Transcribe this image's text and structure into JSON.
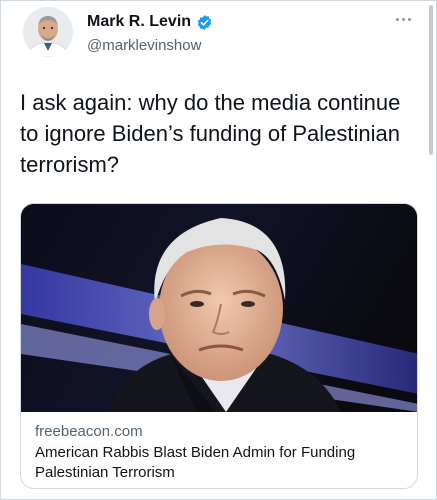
{
  "tweet": {
    "display_name": "Mark R. Levin",
    "handle": "@marklevinshow",
    "verified": true,
    "text": "I ask again: why do the media continue to ignore Biden’s funding of Palestinian terrorism?"
  },
  "card": {
    "domain": "freebeacon.com",
    "title": "American Rabbis Blast Biden Admin for Funding Palestinian Terrorism"
  },
  "icons": {
    "verified": "verified-badge-icon",
    "more": "more-options-icon"
  },
  "colors": {
    "verified_blue": "#1d9bf0",
    "secondary_text": "#536471",
    "border": "#cfd9de"
  }
}
